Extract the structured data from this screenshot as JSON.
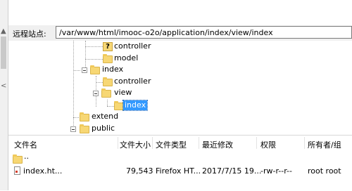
{
  "remote_site": {
    "label": "远程站点:",
    "path": "/var/www/html/imooc-o2o/application/index/view/index"
  },
  "tree": {
    "nodes": [
      {
        "name": "controller",
        "icon": "question-folder-icon"
      },
      {
        "name": "model",
        "icon": "folder-icon"
      },
      {
        "name": "index",
        "icon": "folder-icon",
        "expanded": true
      },
      {
        "name": "controller",
        "icon": "folder-icon"
      },
      {
        "name": "view",
        "icon": "folder-icon",
        "expanded": true
      },
      {
        "name": "index",
        "icon": "folder-icon",
        "selected": true
      },
      {
        "name": "extend",
        "icon": "folder-icon"
      },
      {
        "name": "public",
        "icon": "folder-icon"
      }
    ],
    "question_glyph": "?"
  },
  "file_list": {
    "columns": [
      "文件名",
      "文件大小",
      "文件类型",
      "最近修改",
      "权限",
      "所有者/组"
    ],
    "rows": [
      {
        "name": "..",
        "size": "",
        "type": "",
        "modified": "",
        "permissions": "",
        "owner": ""
      },
      {
        "name": "index.ht...",
        "size": "79,543",
        "type": "Firefox HT...",
        "modified": "2017/7/15 19...",
        "permissions": "-rw-r--r--",
        "owner": "root root"
      }
    ]
  },
  "colors": {
    "selection": "#3399ff",
    "folder": "#f7d774"
  }
}
